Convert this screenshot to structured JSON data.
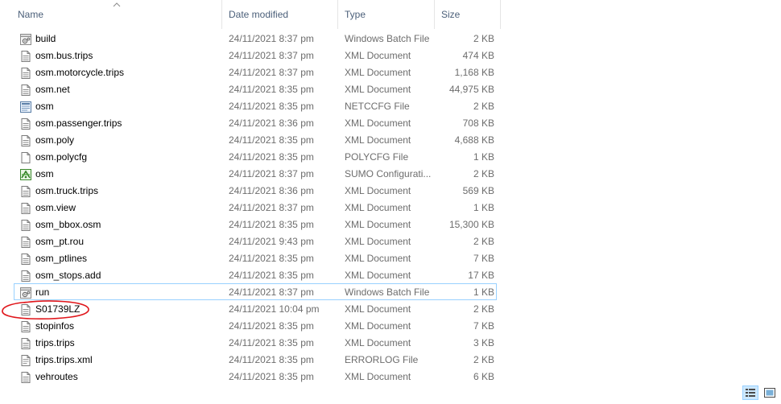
{
  "columns": {
    "name": "Name",
    "date": "Date modified",
    "type": "Type",
    "size": "Size"
  },
  "files": [
    {
      "name": "build",
      "date": "24/11/2021 8:37 pm",
      "type": "Windows Batch File",
      "size": "2 KB",
      "icon": "batch-file-icon"
    },
    {
      "name": "osm.bus.trips",
      "date": "24/11/2021 8:37 pm",
      "type": "XML Document",
      "size": "474 KB",
      "icon": "xml-document-icon"
    },
    {
      "name": "osm.motorcycle.trips",
      "date": "24/11/2021 8:37 pm",
      "type": "XML Document",
      "size": "1,168 KB",
      "icon": "xml-document-icon"
    },
    {
      "name": "osm.net",
      "date": "24/11/2021 8:35 pm",
      "type": "XML Document",
      "size": "44,975 KB",
      "icon": "xml-document-icon"
    },
    {
      "name": "osm",
      "date": "24/11/2021 8:35 pm",
      "type": "NETCCFG File",
      "size": "2 KB",
      "icon": "netccfg-file-icon"
    },
    {
      "name": "osm.passenger.trips",
      "date": "24/11/2021 8:36 pm",
      "type": "XML Document",
      "size": "708 KB",
      "icon": "xml-document-icon"
    },
    {
      "name": "osm.poly",
      "date": "24/11/2021 8:35 pm",
      "type": "XML Document",
      "size": "4,688 KB",
      "icon": "xml-document-icon"
    },
    {
      "name": "osm.polycfg",
      "date": "24/11/2021 8:35 pm",
      "type": "POLYCFG File",
      "size": "1 KB",
      "icon": "blank-file-icon"
    },
    {
      "name": "osm",
      "date": "24/11/2021 8:37 pm",
      "type": "SUMO Configurati...",
      "size": "2 KB",
      "icon": "sumo-config-icon"
    },
    {
      "name": "osm.truck.trips",
      "date": "24/11/2021 8:36 pm",
      "type": "XML Document",
      "size": "569 KB",
      "icon": "xml-document-icon"
    },
    {
      "name": "osm.view",
      "date": "24/11/2021 8:37 pm",
      "type": "XML Document",
      "size": "1 KB",
      "icon": "xml-document-icon"
    },
    {
      "name": "osm_bbox.osm",
      "date": "24/11/2021 8:35 pm",
      "type": "XML Document",
      "size": "15,300 KB",
      "icon": "xml-document-icon"
    },
    {
      "name": "osm_pt.rou",
      "date": "24/11/2021 9:43 pm",
      "type": "XML Document",
      "size": "2 KB",
      "icon": "xml-document-icon"
    },
    {
      "name": "osm_ptlines",
      "date": "24/11/2021 8:35 pm",
      "type": "XML Document",
      "size": "7 KB",
      "icon": "xml-document-icon"
    },
    {
      "name": "osm_stops.add",
      "date": "24/11/2021 8:35 pm",
      "type": "XML Document",
      "size": "17 KB",
      "icon": "xml-document-icon"
    },
    {
      "name": "run",
      "date": "24/11/2021 8:37 pm",
      "type": "Windows Batch File",
      "size": "1 KB",
      "icon": "batch-file-icon",
      "focused": true
    },
    {
      "name": "S01739LZ",
      "date": "24/11/2021 10:04 pm",
      "type": "XML Document",
      "size": "2 KB",
      "icon": "xml-document-icon",
      "circled": true
    },
    {
      "name": "stopinfos",
      "date": "24/11/2021 8:35 pm",
      "type": "XML Document",
      "size": "7 KB",
      "icon": "xml-document-icon"
    },
    {
      "name": "trips.trips",
      "date": "24/11/2021 8:35 pm",
      "type": "XML Document",
      "size": "3 KB",
      "icon": "xml-document-icon"
    },
    {
      "name": "trips.trips.xml",
      "date": "24/11/2021 8:35 pm",
      "type": "ERRORLOG File",
      "size": "2 KB",
      "icon": "errorlog-file-icon"
    },
    {
      "name": "vehroutes",
      "date": "24/11/2021 8:35 pm",
      "type": "XML Document",
      "size": "6 KB",
      "icon": "xml-document-icon"
    }
  ],
  "colors": {
    "header_text": "#4c607a",
    "secondary_text": "#6d6d6d",
    "focus_border": "#99d1ff",
    "annotation": "#e0161b"
  },
  "view_buttons": [
    {
      "icon": "details-view-icon",
      "active": true
    },
    {
      "icon": "large-icons-view-icon",
      "active": false
    }
  ]
}
